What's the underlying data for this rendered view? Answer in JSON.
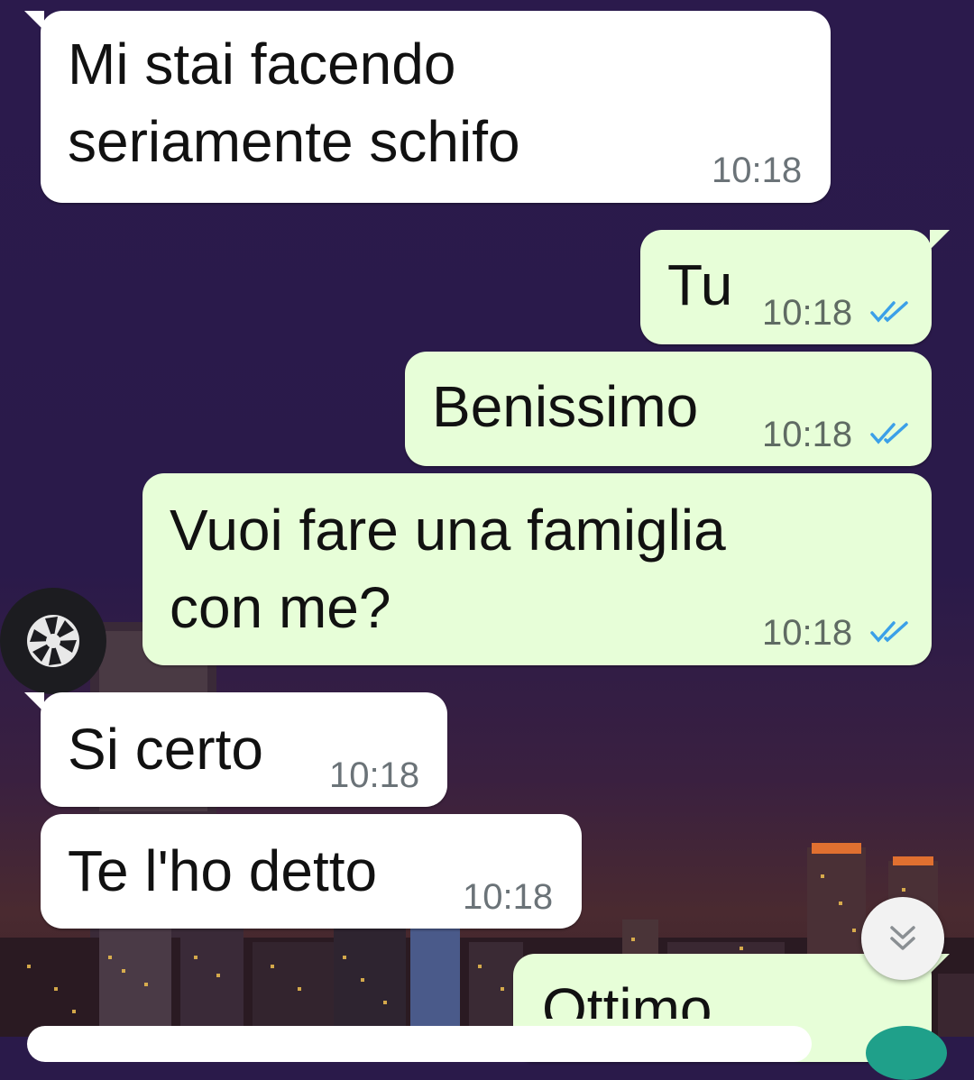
{
  "messages": [
    {
      "text": "Mi stai facendo\nseriamente schifo",
      "time": "10:18",
      "direction": "incoming"
    },
    {
      "text": "Tu",
      "time": "10:18",
      "direction": "outgoing",
      "status": "read"
    },
    {
      "text": "Benissimo",
      "time": "10:18",
      "direction": "outgoing",
      "status": "read"
    },
    {
      "text": "Vuoi fare una famiglia\ncon me?",
      "time": "10:18",
      "direction": "outgoing",
      "status": "read"
    },
    {
      "text": "Si certo",
      "time": "10:18",
      "direction": "incoming"
    },
    {
      "text": "Te l'ho detto",
      "time": "10:18",
      "direction": "incoming"
    },
    {
      "text": "Ottimo",
      "direction": "outgoing"
    }
  ],
  "icons": {
    "camera": "camera-shutter-icon",
    "scroll": "double-chevron-down-icon",
    "read_ticks": "double-check-icon"
  },
  "colors": {
    "incoming_bubble": "#ffffff",
    "outgoing_bubble": "#e7fed8",
    "read_tick": "#3ba0e8",
    "timestamp": "#6b7378"
  }
}
